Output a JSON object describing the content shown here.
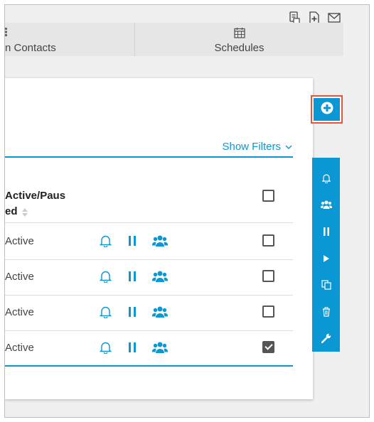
{
  "tabs": [
    {
      "label": "n Contacts",
      "icon": "grid-icon"
    },
    {
      "label": "Schedules",
      "icon": "calendar-icon"
    }
  ],
  "top_icons": [
    "export-text-icon",
    "export-add-icon",
    "mail-icon"
  ],
  "filters": {
    "label": "Show Filters",
    "icon": "chevron-down-icon"
  },
  "table": {
    "header": {
      "line1": "Active/Paus",
      "line2": "ed"
    },
    "rows": [
      {
        "status": "Active",
        "checked": false
      },
      {
        "status": "Active",
        "checked": false
      },
      {
        "status": "Active",
        "checked": false
      },
      {
        "status": "Active",
        "checked": true
      }
    ]
  },
  "side_actions": [
    "bell-icon",
    "group-icon",
    "pause-icon",
    "play-icon",
    "copy-icon",
    "trash-icon",
    "wrench-icon"
  ],
  "colors": {
    "accent": "#0a97d3",
    "highlight": "#e8533b"
  }
}
